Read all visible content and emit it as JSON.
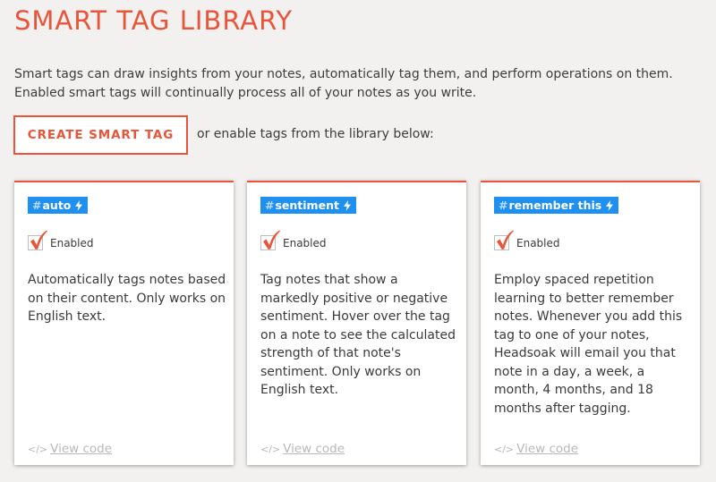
{
  "header": {
    "title": "SMART TAG LIBRARY",
    "intro": "Smart tags can draw insights from your notes, automatically tag them, and perform operations on them. Enabled smart tags will continually process all of your notes as you write."
  },
  "actions": {
    "create_label": "CREATE SMART TAG",
    "or_text": "or enable tags from the library below:"
  },
  "colors": {
    "accent": "#e8553a",
    "tag_blue": "#1f8ff0",
    "background": "#f2f1ef"
  },
  "cards": [
    {
      "hash": "#",
      "tag": "auto",
      "icon": "lightning-bolt-icon",
      "enabled": true,
      "enabled_label": "Enabled",
      "description": "Automatically tags notes based on their content. Only works on English text.",
      "code_icon": "</>",
      "view_code": "View code"
    },
    {
      "hash": "#",
      "tag": "sentiment",
      "icon": "lightning-bolt-icon",
      "enabled": true,
      "enabled_label": "Enabled",
      "description": "Tag notes that show a markedly positive or negative sentiment. Hover over the tag on a note to see the calculated strength of that note's sentiment. Only works on English text.",
      "code_icon": "</>",
      "view_code": "View code"
    },
    {
      "hash": "#",
      "tag": "remember this",
      "icon": "lightning-bolt-icon",
      "enabled": true,
      "enabled_label": "Enabled",
      "description": "Employ spaced repetition learning to better remember notes. Whenever you add this tag to one of your notes, Headsoak will email you that note in a day, a week, a month, 4 months, and 18 months after tagging.",
      "code_icon": "</>",
      "view_code": "View code"
    }
  ]
}
